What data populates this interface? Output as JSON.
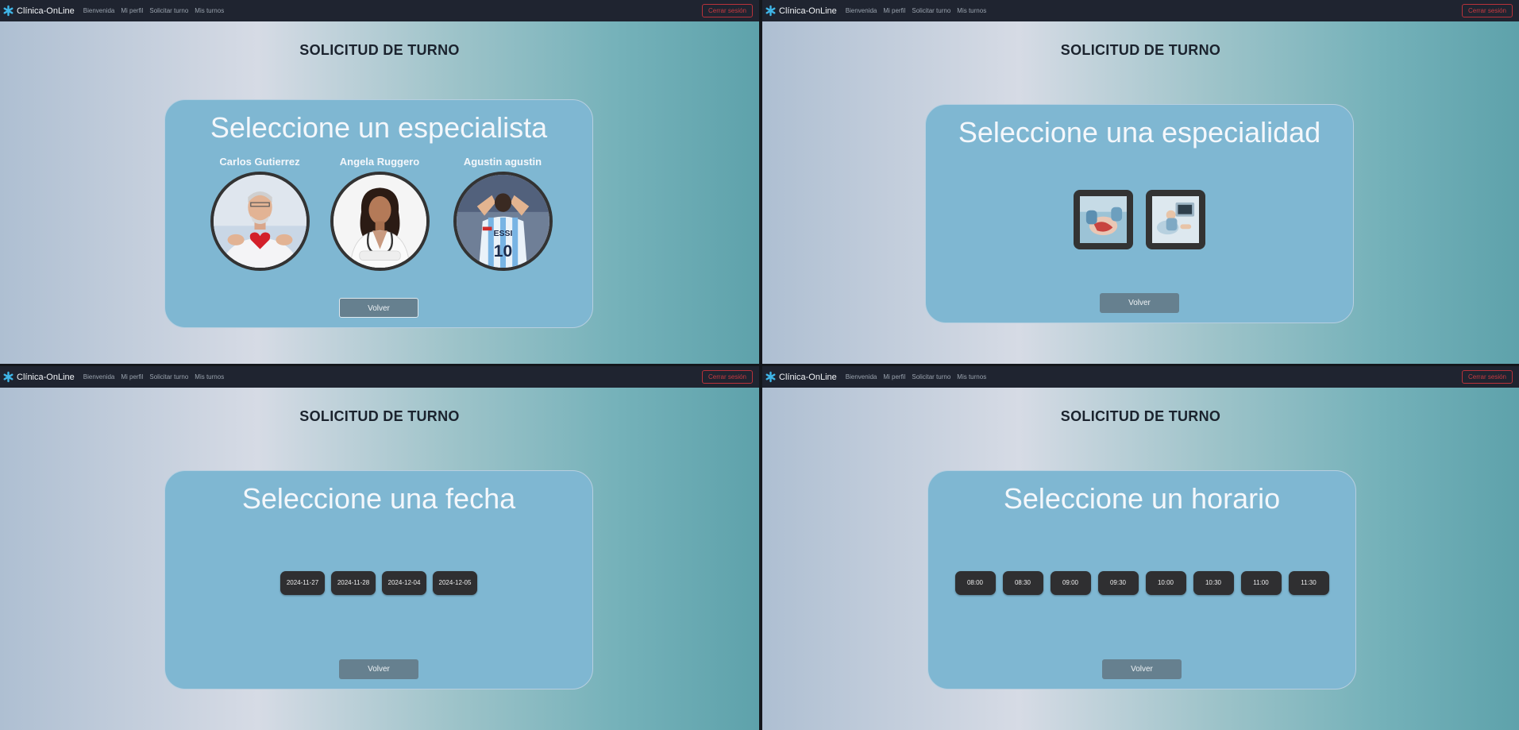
{
  "navbar": {
    "brand": "Clínica-OnLine",
    "links": [
      "Bienvenida",
      "Mi perfil",
      "Solicitar turno",
      "Mis turnos"
    ],
    "logout_label": "Cerrar sesión"
  },
  "page_title": "SOLICITUD DE TURNO",
  "back_label": "Volver",
  "step_specialist": {
    "title": "Seleccione un especialista",
    "doctors": [
      {
        "name": "Carlos Gutierrez",
        "photo": "doctor-holding-heart"
      },
      {
        "name": "Angela Ruggero",
        "photo": "female-doctor-stethoscope"
      },
      {
        "name": "Agustin agustin",
        "photo": "football-player-jersey"
      }
    ]
  },
  "step_specialty": {
    "title": "Seleccione una especialidad",
    "specialties": [
      {
        "image": "surgery-icon"
      },
      {
        "image": "ultrasound-icon"
      }
    ]
  },
  "step_date": {
    "title": "Seleccione una fecha",
    "dates": [
      "2024-11-27",
      "2024-11-28",
      "2024-12-04",
      "2024-12-05"
    ]
  },
  "step_time": {
    "title": "Seleccione un horario",
    "times": [
      "08:00",
      "08:30",
      "09:00",
      "09:30",
      "10:00",
      "10:30",
      "11:00",
      "11:30"
    ]
  },
  "colors": {
    "navbar": "#1f2430",
    "card": "#7fb7d2",
    "chip": "#2f2f31",
    "logout": "#c83a40"
  }
}
